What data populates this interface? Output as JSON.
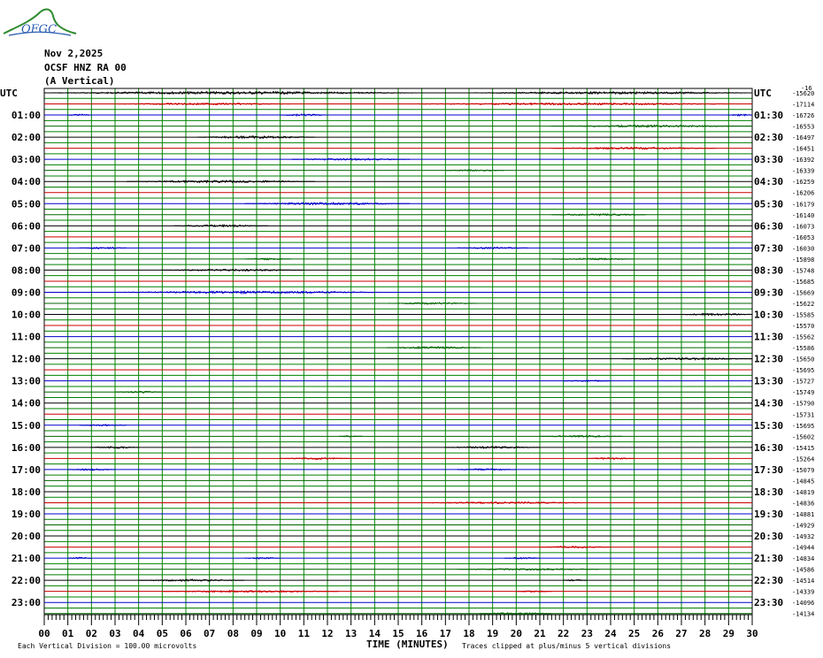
{
  "header": {
    "logo_text": "OFGC",
    "date": "Nov 2,2025",
    "station": "OCSF HNZ RA 00",
    "component": "(A Vertical)"
  },
  "chart_data": {
    "type": "line",
    "title": "Nov 2,2025 OCSF HNZ RA 00 (A Vertical)",
    "left_axis_title": "UTC",
    "right_axis_title": "UTC",
    "xlabel": "TIME (MINUTES)",
    "xlim": [
      0,
      30
    ],
    "x_ticks": [
      "00",
      "01",
      "02",
      "03",
      "04",
      "05",
      "06",
      "07",
      "08",
      "09",
      "10",
      "11",
      "12",
      "13",
      "14",
      "15",
      "16",
      "17",
      "18",
      "19",
      "20",
      "21",
      "22",
      "23",
      "24",
      "25",
      "26",
      "27",
      "28",
      "29",
      "30"
    ],
    "left_row_labels": [
      "UTC",
      "01:00",
      "02:00",
      "03:00",
      "04:00",
      "05:00",
      "06:00",
      "07:00",
      "08:00",
      "09:00",
      "10:00",
      "11:00",
      "12:00",
      "13:00",
      "14:00",
      "15:00",
      "16:00",
      "17:00",
      "18:00",
      "19:00",
      "20:00",
      "21:00",
      "22:00",
      "23:00"
    ],
    "right_row_labels": [
      "UTC",
      "01:30",
      "02:30",
      "03:30",
      "04:30",
      "05:30",
      "06:30",
      "07:30",
      "08:30",
      "09:30",
      "10:30",
      "11:30",
      "12:30",
      "13:30",
      "14:30",
      "15:30",
      "16:30",
      "17:30",
      "18:30",
      "19:30",
      "20:30",
      "21:30",
      "22:30",
      "23:30"
    ],
    "offsets": [
      "-15620",
      "-17114",
      "-16726",
      "-16553",
      "-16497",
      "-16451",
      "-16392",
      "-16339",
      "-16259",
      "-16206",
      "-16179",
      "-16140",
      "-16073",
      "-16053",
      "-16030",
      "-15898",
      "-15748",
      "-15685",
      "-15669",
      "-15622",
      "-15585",
      "-15570",
      "-15562",
      "-15586",
      "-15650",
      "-15695",
      "-15727",
      "-15749",
      "-15790",
      "-15731",
      "-15695",
      "-15602",
      "-15415",
      "-15264",
      "-15079",
      "-14845",
      "-14819",
      "-14836",
      "-14881",
      "-14929",
      "-14932",
      "-14944",
      "-14834",
      "-14586",
      "-14514",
      "-14339",
      "-14096",
      "-14134"
    ],
    "offset_top_label": "-16",
    "trace_colors": [
      "#000000",
      "#cc0000",
      "#0000cc",
      "#006600"
    ],
    "grid": true,
    "grid_color": "#008000",
    "footer_left": "Each Vertical Division =  100.00 microvolts",
    "footer_right": "Traces clipped at plus/minus 5 vertical divisions",
    "bursts": [
      {
        "row": 0,
        "x0": 0.0,
        "x1": 16.0,
        "amp": 1.2
      },
      {
        "row": 0,
        "x0": 18.0,
        "x1": 30.0,
        "amp": 1.0
      },
      {
        "row": 1,
        "x0": 3.0,
        "x1": 10.5,
        "amp": 0.8
      },
      {
        "row": 1,
        "x0": 15.5,
        "x1": 29.5,
        "amp": 0.9
      },
      {
        "row": 2,
        "x0": 1.0,
        "x1": 2.0,
        "amp": 0.8
      },
      {
        "row": 2,
        "x0": 10.0,
        "x1": 12.0,
        "amp": 0.9
      },
      {
        "row": 2,
        "x0": 29.0,
        "x1": 30.0,
        "amp": 0.8
      },
      {
        "row": 3,
        "x0": 21.5,
        "x1": 30.0,
        "amp": 0.9
      },
      {
        "row": 4,
        "x0": 6.5,
        "x1": 11.5,
        "amp": 1.1
      },
      {
        "row": 5,
        "x0": 21.5,
        "x1": 28.5,
        "amp": 0.9
      },
      {
        "row": 6,
        "x0": 10.5,
        "x1": 15.5,
        "amp": 0.9
      },
      {
        "row": 7,
        "x0": 17.0,
        "x1": 19.5,
        "amp": 0.7
      },
      {
        "row": 8,
        "x0": 3.5,
        "x1": 11.5,
        "amp": 1.0
      },
      {
        "row": 10,
        "x0": 8.5,
        "x1": 15.5,
        "amp": 1.0
      },
      {
        "row": 11,
        "x0": 21.5,
        "x1": 25.5,
        "amp": 0.9
      },
      {
        "row": 12,
        "x0": 5.5,
        "x1": 9.5,
        "amp": 0.9
      },
      {
        "row": 14,
        "x0": 1.5,
        "x1": 3.5,
        "amp": 0.8
      },
      {
        "row": 14,
        "x0": 17.5,
        "x1": 20.5,
        "amp": 0.8
      },
      {
        "row": 15,
        "x0": 8.5,
        "x1": 10.5,
        "amp": 0.7
      },
      {
        "row": 15,
        "x0": 21.5,
        "x1": 25.0,
        "amp": 0.8
      },
      {
        "row": 16,
        "x0": 5.0,
        "x1": 11.0,
        "amp": 0.9
      },
      {
        "row": 18,
        "x0": 3.0,
        "x1": 14.5,
        "amp": 1.1
      },
      {
        "row": 19,
        "x0": 14.5,
        "x1": 18.5,
        "amp": 0.8
      },
      {
        "row": 20,
        "x0": 27.0,
        "x1": 30.0,
        "amp": 1.0
      },
      {
        "row": 23,
        "x0": 14.5,
        "x1": 18.5,
        "amp": 0.9
      },
      {
        "row": 24,
        "x0": 24.5,
        "x1": 30.0,
        "amp": 0.9
      },
      {
        "row": 26,
        "x0": 22.0,
        "x1": 24.0,
        "amp": 0.7
      },
      {
        "row": 27,
        "x0": 3.0,
        "x1": 5.0,
        "amp": 0.8
      },
      {
        "row": 30,
        "x0": 1.5,
        "x1": 3.5,
        "amp": 0.8
      },
      {
        "row": 31,
        "x0": 12.5,
        "x1": 13.5,
        "amp": 0.7
      },
      {
        "row": 31,
        "x0": 21.0,
        "x1": 24.5,
        "amp": 0.8
      },
      {
        "row": 32,
        "x0": 2.0,
        "x1": 4.0,
        "amp": 0.9
      },
      {
        "row": 32,
        "x0": 17.0,
        "x1": 21.0,
        "amp": 0.9
      },
      {
        "row": 33,
        "x0": 10.0,
        "x1": 13.0,
        "amp": 0.8
      },
      {
        "row": 33,
        "x0": 23.0,
        "x1": 25.0,
        "amp": 0.8
      },
      {
        "row": 34,
        "x0": 1.0,
        "x1": 3.0,
        "amp": 0.8
      },
      {
        "row": 34,
        "x0": 17.5,
        "x1": 20.0,
        "amp": 0.7
      },
      {
        "row": 37,
        "x0": 16.0,
        "x1": 23.0,
        "amp": 0.9
      },
      {
        "row": 41,
        "x0": 21.0,
        "x1": 24.0,
        "amp": 0.8
      },
      {
        "row": 42,
        "x0": 1.0,
        "x1": 2.0,
        "amp": 0.8
      },
      {
        "row": 42,
        "x0": 8.5,
        "x1": 10.0,
        "amp": 0.7
      },
      {
        "row": 42,
        "x0": 19.5,
        "x1": 21.0,
        "amp": 0.8
      },
      {
        "row": 43,
        "x0": 17.5,
        "x1": 23.5,
        "amp": 0.8
      },
      {
        "row": 44,
        "x0": 4.0,
        "x1": 8.5,
        "amp": 0.9
      },
      {
        "row": 44,
        "x0": 22.0,
        "x1": 23.0,
        "amp": 0.7
      },
      {
        "row": 45,
        "x0": 5.0,
        "x1": 12.5,
        "amp": 0.8
      },
      {
        "row": 45,
        "x0": 20.0,
        "x1": 21.5,
        "amp": 0.7
      },
      {
        "row": 47,
        "x0": 18.5,
        "x1": 21.5,
        "amp": 0.8
      }
    ]
  }
}
